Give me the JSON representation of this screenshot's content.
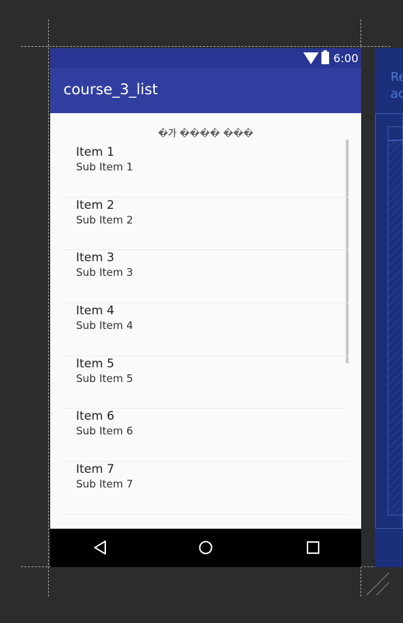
{
  "status_bar": {
    "time": "6:00",
    "wifi_icon": "wifi-icon",
    "battery_icon": "battery-icon"
  },
  "app_bar": {
    "title": "course_3_list"
  },
  "list": {
    "header": "�가 ���� ���",
    "items": [
      {
        "title": "Item 1",
        "subtitle": "Sub Item 1"
      },
      {
        "title": "Item 2",
        "subtitle": "Sub Item 2"
      },
      {
        "title": "Item 3",
        "subtitle": "Sub Item 3"
      },
      {
        "title": "Item 4",
        "subtitle": "Sub Item 4"
      },
      {
        "title": "Item 5",
        "subtitle": "Sub Item 5"
      },
      {
        "title": "Item 6",
        "subtitle": "Sub Item 6"
      },
      {
        "title": "Item 7",
        "subtitle": "Sub Item 7"
      }
    ]
  },
  "nav_bar": {
    "back_icon": "back-triangle-icon",
    "home_icon": "home-circle-icon",
    "recents_icon": "recents-square-icon"
  },
  "blueprint": {
    "title": "Re\nac"
  },
  "colors": {
    "status_bar": "#283593",
    "app_bar": "#303f9f",
    "background": "#2b2c2e",
    "blueprint": "#1c2f7a"
  }
}
